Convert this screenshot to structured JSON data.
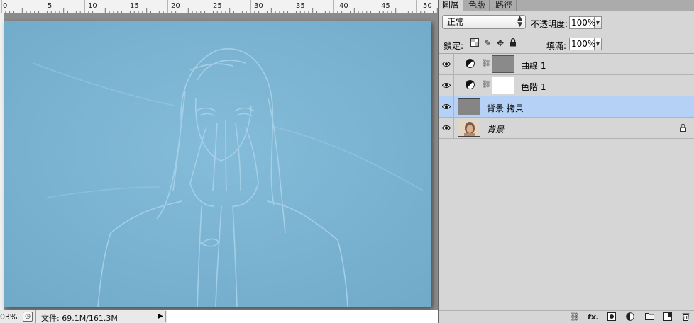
{
  "ruler": {
    "labels": [
      "0",
      "5",
      "10",
      "15",
      "20",
      "25",
      "30",
      "35",
      "40",
      "45",
      "50"
    ]
  },
  "status": {
    "zoom": "03%",
    "doc_info": "文件: 69.1M/161.3M"
  },
  "panel": {
    "tabs": [
      {
        "label": "圖層",
        "active": true
      },
      {
        "label": "色版",
        "active": false
      },
      {
        "label": "路徑",
        "active": false
      }
    ],
    "blend_mode": "正常",
    "opacity_label": "不透明度:",
    "opacity_value": "100%",
    "lock_label": "鎖定:",
    "fill_label": "填滿:",
    "fill_value": "100%",
    "layers": [
      {
        "name": "曲線 1",
        "type": "adjustment-curves",
        "selected": false
      },
      {
        "name": "色階 1",
        "type": "adjustment-levels",
        "selected": false
      },
      {
        "name": "背景 拷貝",
        "type": "pixel",
        "selected": true
      },
      {
        "name": "背景",
        "type": "background",
        "selected": false,
        "locked": true
      }
    ]
  },
  "colors": {
    "canvas_blue": "#7ab3d2",
    "selected_row": "#b5d2f6"
  }
}
